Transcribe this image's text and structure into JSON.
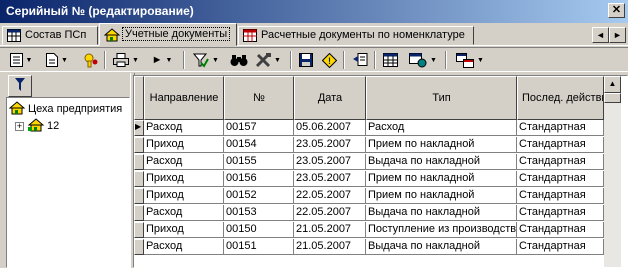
{
  "window": {
    "title": "Серийный № (редактирование)",
    "close_label": "✕"
  },
  "tabs": [
    {
      "label": "Состав ПСп",
      "icon": "table-icon",
      "active": false
    },
    {
      "label": "Учетные документы",
      "icon": "folder-house-icon",
      "active": true
    },
    {
      "label": "Расчетные документы по номенклатуре",
      "icon": "table-red-icon",
      "active": false
    }
  ],
  "tab_nav": {
    "prev": "◄",
    "next": "►"
  },
  "toolbar": {
    "icons": [
      "document-list-icon",
      "new-document-icon",
      "key-icon",
      "print-icon",
      "run-icon",
      "filter-check-icon",
      "binoculars-icon",
      "tools-icon",
      "save-icon",
      "warning-icon",
      "export-icon",
      "table-view-icon",
      "settings-icon",
      "link-icon"
    ],
    "dropdown_glyph": "▼",
    "run_glyph": "►"
  },
  "left_panel": {
    "filter_icon": "funnel-icon",
    "tree": [
      {
        "label": "Цеха предприятия",
        "level": 0
      },
      {
        "label": "12",
        "level": 1,
        "expander": "+"
      }
    ]
  },
  "table": {
    "columns": [
      "Направление",
      "№",
      "Дата",
      "Тип",
      "Послед. действие"
    ],
    "current_row_marker": "▶",
    "rows": [
      {
        "dir": "Расход",
        "num": "00157",
        "date": "05.06.2007",
        "type": "Расход",
        "last": "Стандартная"
      },
      {
        "dir": "Приход",
        "num": "00154",
        "date": "23.05.2007",
        "type": "Прием по накладной",
        "last": "Стандартная"
      },
      {
        "dir": "Расход",
        "num": "00155",
        "date": "23.05.2007",
        "type": "Выдача по накладной",
        "last": "Стандартная"
      },
      {
        "dir": "Приход",
        "num": "00156",
        "date": "23.05.2007",
        "type": "Прием по накладной",
        "last": "Стандартная"
      },
      {
        "dir": "Приход",
        "num": "00152",
        "date": "22.05.2007",
        "type": "Прием по накладной",
        "last": "Стандартная"
      },
      {
        "dir": "Расход",
        "num": "00153",
        "date": "22.05.2007",
        "type": "Выдача по накладной",
        "last": "Стандартная"
      },
      {
        "dir": "Приход",
        "num": "00150",
        "date": "21.05.2007",
        "type": "Поступление из производства",
        "last": "Стандартная"
      },
      {
        "dir": "Расход",
        "num": "00151",
        "date": "21.05.2007",
        "type": "Выдача по накладной",
        "last": "Стандартная"
      }
    ]
  },
  "scrollbar": {
    "up": "▲"
  }
}
